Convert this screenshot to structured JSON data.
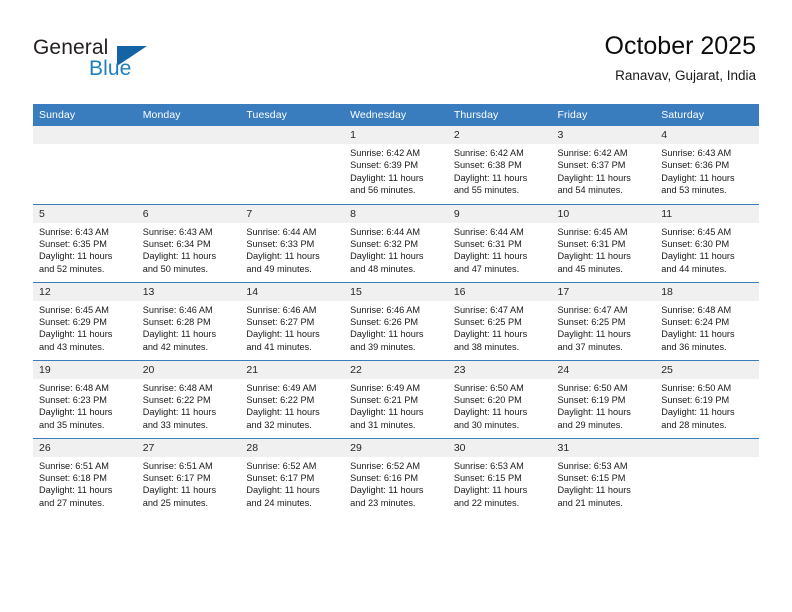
{
  "brand": {
    "name_part1": "General",
    "name_part2": "Blue",
    "accent_color": "#1463a5",
    "logo_icon": "triangle-flag-icon"
  },
  "header": {
    "title": "October 2025",
    "subtitle": "Ranavav, Gujarat, India"
  },
  "theme": {
    "header_row_bg": "#3a7dbf",
    "daynum_bg": "#f0f0f0",
    "row_divider": "#3a7dbf",
    "text": "#1a1a1a"
  },
  "calendar": {
    "weekday_headers": [
      "Sunday",
      "Monday",
      "Tuesday",
      "Wednesday",
      "Thursday",
      "Friday",
      "Saturday"
    ],
    "labels": {
      "sunrise": "Sunrise:",
      "sunset": "Sunset:",
      "daylight": "Daylight:"
    },
    "weeks": [
      [
        {
          "day": "",
          "sunrise": "",
          "sunset": "",
          "daylight_line1": "",
          "daylight_line2": ""
        },
        {
          "day": "",
          "sunrise": "",
          "sunset": "",
          "daylight_line1": "",
          "daylight_line2": ""
        },
        {
          "day": "",
          "sunrise": "",
          "sunset": "",
          "daylight_line1": "",
          "daylight_line2": ""
        },
        {
          "day": "1",
          "sunrise": "Sunrise: 6:42 AM",
          "sunset": "Sunset: 6:39 PM",
          "daylight_line1": "Daylight: 11 hours",
          "daylight_line2": "and 56 minutes."
        },
        {
          "day": "2",
          "sunrise": "Sunrise: 6:42 AM",
          "sunset": "Sunset: 6:38 PM",
          "daylight_line1": "Daylight: 11 hours",
          "daylight_line2": "and 55 minutes."
        },
        {
          "day": "3",
          "sunrise": "Sunrise: 6:42 AM",
          "sunset": "Sunset: 6:37 PM",
          "daylight_line1": "Daylight: 11 hours",
          "daylight_line2": "and 54 minutes."
        },
        {
          "day": "4",
          "sunrise": "Sunrise: 6:43 AM",
          "sunset": "Sunset: 6:36 PM",
          "daylight_line1": "Daylight: 11 hours",
          "daylight_line2": "and 53 minutes."
        }
      ],
      [
        {
          "day": "5",
          "sunrise": "Sunrise: 6:43 AM",
          "sunset": "Sunset: 6:35 PM",
          "daylight_line1": "Daylight: 11 hours",
          "daylight_line2": "and 52 minutes."
        },
        {
          "day": "6",
          "sunrise": "Sunrise: 6:43 AM",
          "sunset": "Sunset: 6:34 PM",
          "daylight_line1": "Daylight: 11 hours",
          "daylight_line2": "and 50 minutes."
        },
        {
          "day": "7",
          "sunrise": "Sunrise: 6:44 AM",
          "sunset": "Sunset: 6:33 PM",
          "daylight_line1": "Daylight: 11 hours",
          "daylight_line2": "and 49 minutes."
        },
        {
          "day": "8",
          "sunrise": "Sunrise: 6:44 AM",
          "sunset": "Sunset: 6:32 PM",
          "daylight_line1": "Daylight: 11 hours",
          "daylight_line2": "and 48 minutes."
        },
        {
          "day": "9",
          "sunrise": "Sunrise: 6:44 AM",
          "sunset": "Sunset: 6:31 PM",
          "daylight_line1": "Daylight: 11 hours",
          "daylight_line2": "and 47 minutes."
        },
        {
          "day": "10",
          "sunrise": "Sunrise: 6:45 AM",
          "sunset": "Sunset: 6:31 PM",
          "daylight_line1": "Daylight: 11 hours",
          "daylight_line2": "and 45 minutes."
        },
        {
          "day": "11",
          "sunrise": "Sunrise: 6:45 AM",
          "sunset": "Sunset: 6:30 PM",
          "daylight_line1": "Daylight: 11 hours",
          "daylight_line2": "and 44 minutes."
        }
      ],
      [
        {
          "day": "12",
          "sunrise": "Sunrise: 6:45 AM",
          "sunset": "Sunset: 6:29 PM",
          "daylight_line1": "Daylight: 11 hours",
          "daylight_line2": "and 43 minutes."
        },
        {
          "day": "13",
          "sunrise": "Sunrise: 6:46 AM",
          "sunset": "Sunset: 6:28 PM",
          "daylight_line1": "Daylight: 11 hours",
          "daylight_line2": "and 42 minutes."
        },
        {
          "day": "14",
          "sunrise": "Sunrise: 6:46 AM",
          "sunset": "Sunset: 6:27 PM",
          "daylight_line1": "Daylight: 11 hours",
          "daylight_line2": "and 41 minutes."
        },
        {
          "day": "15",
          "sunrise": "Sunrise: 6:46 AM",
          "sunset": "Sunset: 6:26 PM",
          "daylight_line1": "Daylight: 11 hours",
          "daylight_line2": "and 39 minutes."
        },
        {
          "day": "16",
          "sunrise": "Sunrise: 6:47 AM",
          "sunset": "Sunset: 6:25 PM",
          "daylight_line1": "Daylight: 11 hours",
          "daylight_line2": "and 38 minutes."
        },
        {
          "day": "17",
          "sunrise": "Sunrise: 6:47 AM",
          "sunset": "Sunset: 6:25 PM",
          "daylight_line1": "Daylight: 11 hours",
          "daylight_line2": "and 37 minutes."
        },
        {
          "day": "18",
          "sunrise": "Sunrise: 6:48 AM",
          "sunset": "Sunset: 6:24 PM",
          "daylight_line1": "Daylight: 11 hours",
          "daylight_line2": "and 36 minutes."
        }
      ],
      [
        {
          "day": "19",
          "sunrise": "Sunrise: 6:48 AM",
          "sunset": "Sunset: 6:23 PM",
          "daylight_line1": "Daylight: 11 hours",
          "daylight_line2": "and 35 minutes."
        },
        {
          "day": "20",
          "sunrise": "Sunrise: 6:48 AM",
          "sunset": "Sunset: 6:22 PM",
          "daylight_line1": "Daylight: 11 hours",
          "daylight_line2": "and 33 minutes."
        },
        {
          "day": "21",
          "sunrise": "Sunrise: 6:49 AM",
          "sunset": "Sunset: 6:22 PM",
          "daylight_line1": "Daylight: 11 hours",
          "daylight_line2": "and 32 minutes."
        },
        {
          "day": "22",
          "sunrise": "Sunrise: 6:49 AM",
          "sunset": "Sunset: 6:21 PM",
          "daylight_line1": "Daylight: 11 hours",
          "daylight_line2": "and 31 minutes."
        },
        {
          "day": "23",
          "sunrise": "Sunrise: 6:50 AM",
          "sunset": "Sunset: 6:20 PM",
          "daylight_line1": "Daylight: 11 hours",
          "daylight_line2": "and 30 minutes."
        },
        {
          "day": "24",
          "sunrise": "Sunrise: 6:50 AM",
          "sunset": "Sunset: 6:19 PM",
          "daylight_line1": "Daylight: 11 hours",
          "daylight_line2": "and 29 minutes."
        },
        {
          "day": "25",
          "sunrise": "Sunrise: 6:50 AM",
          "sunset": "Sunset: 6:19 PM",
          "daylight_line1": "Daylight: 11 hours",
          "daylight_line2": "and 28 minutes."
        }
      ],
      [
        {
          "day": "26",
          "sunrise": "Sunrise: 6:51 AM",
          "sunset": "Sunset: 6:18 PM",
          "daylight_line1": "Daylight: 11 hours",
          "daylight_line2": "and 27 minutes."
        },
        {
          "day": "27",
          "sunrise": "Sunrise: 6:51 AM",
          "sunset": "Sunset: 6:17 PM",
          "daylight_line1": "Daylight: 11 hours",
          "daylight_line2": "and 25 minutes."
        },
        {
          "day": "28",
          "sunrise": "Sunrise: 6:52 AM",
          "sunset": "Sunset: 6:17 PM",
          "daylight_line1": "Daylight: 11 hours",
          "daylight_line2": "and 24 minutes."
        },
        {
          "day": "29",
          "sunrise": "Sunrise: 6:52 AM",
          "sunset": "Sunset: 6:16 PM",
          "daylight_line1": "Daylight: 11 hours",
          "daylight_line2": "and 23 minutes."
        },
        {
          "day": "30",
          "sunrise": "Sunrise: 6:53 AM",
          "sunset": "Sunset: 6:15 PM",
          "daylight_line1": "Daylight: 11 hours",
          "daylight_line2": "and 22 minutes."
        },
        {
          "day": "31",
          "sunrise": "Sunrise: 6:53 AM",
          "sunset": "Sunset: 6:15 PM",
          "daylight_line1": "Daylight: 11 hours",
          "daylight_line2": "and 21 minutes."
        },
        {
          "day": "",
          "sunrise": "",
          "sunset": "",
          "daylight_line1": "",
          "daylight_line2": ""
        }
      ]
    ]
  }
}
